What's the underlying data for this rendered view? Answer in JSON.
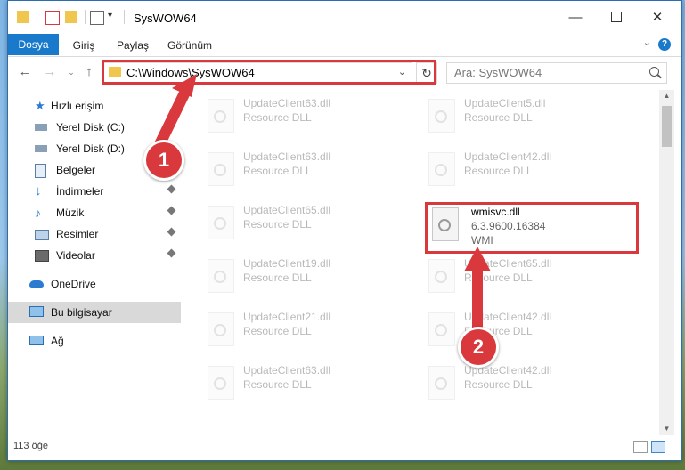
{
  "window": {
    "title": "SysWOW64",
    "controls": [
      "minimize-icon",
      "maximize-icon",
      "close-icon"
    ]
  },
  "ribbon": {
    "tabs": [
      "Dosya",
      "Giriş",
      "Paylaş",
      "Görünüm"
    ],
    "active_tab": "Dosya",
    "accent_color": "#1979ca"
  },
  "address": {
    "path": "C:\\Windows\\SysWOW64",
    "search_placeholder": "Ara: SysWOW64"
  },
  "sidebar": {
    "items": [
      {
        "label": "Hızlı erişim",
        "icon": "star-icon"
      },
      {
        "label": "Yerel Disk (C:)",
        "icon": "drive-icon",
        "pinned": false
      },
      {
        "label": "Yerel Disk (D:)",
        "icon": "drive-icon",
        "pinned": false
      },
      {
        "label": "Belgeler",
        "icon": "documents-icon",
        "pinned": false
      },
      {
        "label": "İndirmeler",
        "icon": "download-icon",
        "pinned": true
      },
      {
        "label": "Müzik",
        "icon": "music-icon",
        "pinned": true
      },
      {
        "label": "Resimler",
        "icon": "pictures-icon",
        "pinned": true
      },
      {
        "label": "Videolar",
        "icon": "video-icon",
        "pinned": true
      },
      {
        "label": "OneDrive",
        "icon": "cloud-icon"
      },
      {
        "label": "Bu bilgisayar",
        "icon": "computer-icon",
        "selected": true
      },
      {
        "label": "Ağ",
        "icon": "network-icon"
      }
    ]
  },
  "files": [
    {
      "name": "UpdateClient63.dll",
      "type": "Resource DLL"
    },
    {
      "name": "UpdateClient5.dll",
      "type": "Resource DLL"
    },
    {
      "name": "UpdateClient63.dll",
      "type": "Resource DLL"
    },
    {
      "name": "UpdateClient42.dll",
      "type": "Resource DLL"
    },
    {
      "name": "UpdateClient65.dll",
      "type": "Resource DLL"
    },
    {
      "name": "wmisvc.dll",
      "version": "6.3.9600.16384",
      "type": "WMI",
      "highlighted": true
    },
    {
      "name": "UpdateClient19.dll",
      "type": "Resource DLL"
    },
    {
      "name": "UpdateClient65.dll",
      "type": "Resource DLL"
    },
    {
      "name": "UpdateClient21.dll",
      "type": "Resource DLL"
    },
    {
      "name": "UpdateClient42.dll",
      "type": "Resource DLL"
    },
    {
      "name": "UpdateClient63.dll",
      "type": "Resource DLL"
    },
    {
      "name": "UpdateClient42.dll",
      "type": "Resource DLL"
    }
  ],
  "status": {
    "item_count": "113 öğe"
  },
  "annotations": {
    "badge_1": "1",
    "badge_2": "2",
    "color": "#d9393c"
  }
}
